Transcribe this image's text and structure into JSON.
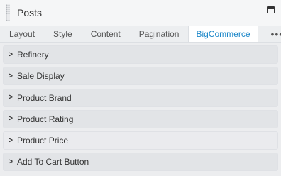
{
  "header": {
    "title": "Posts"
  },
  "tabs": [
    {
      "label": "Layout",
      "name": "tab-layout"
    },
    {
      "label": "Style",
      "name": "tab-style"
    },
    {
      "label": "Content",
      "name": "tab-content"
    },
    {
      "label": "Pagination",
      "name": "tab-pagination"
    },
    {
      "label": "BigCommerce",
      "name": "tab-bigcommerce",
      "active": true
    },
    {
      "label": "•••",
      "name": "tab-more"
    }
  ],
  "sections": [
    {
      "label": "Refinery"
    },
    {
      "label": "Sale Display"
    },
    {
      "label": "Product Brand"
    },
    {
      "label": "Product Rating"
    },
    {
      "label": "Product Price"
    },
    {
      "label": "Add To Cart Button"
    }
  ],
  "chevron_glyph": ">",
  "colors": {
    "active_tab": "#1e88c9",
    "header_bg": "#f5f6f7",
    "section_bg": "#e2e4e7"
  }
}
